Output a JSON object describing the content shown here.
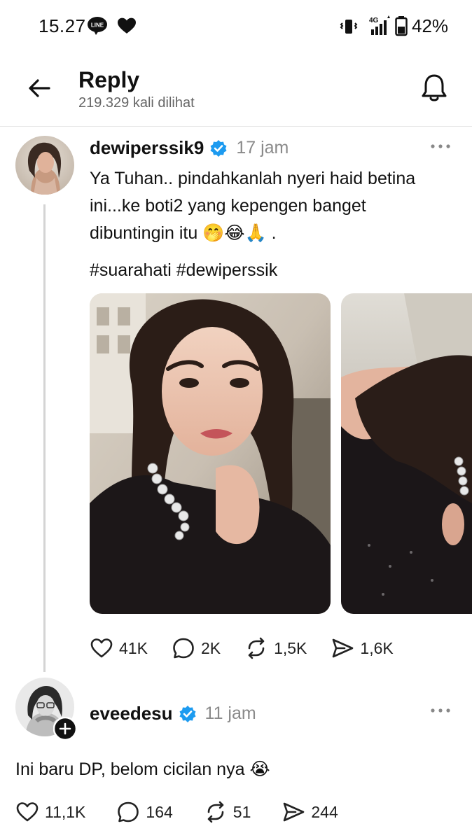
{
  "status_bar": {
    "time": "15.27",
    "line_badge": "LINE",
    "network": "4G",
    "battery": "42%"
  },
  "header": {
    "title": "Reply",
    "views": "219.329 kali dilihat"
  },
  "post": {
    "username": "dewiperssik9",
    "time_ago": "17 jam",
    "text_line1": "Ya Tuhan.. pindahkanlah nyeri haid betina",
    "text_line2": "ini...ke boti2 yang kepengen banget",
    "text_line3": "dibuntingin itu",
    "emojis": "🤭😂🙏",
    "text_end": ".",
    "hashtags": "#suarahati #dewiperssik",
    "likes": "41K",
    "replies": "2K",
    "reposts": "1,5K",
    "shares": "1,6K"
  },
  "reply": {
    "username": "eveedesu",
    "time_ago": "11 jam",
    "text": "Ini baru DP, belom cicilan nya",
    "emoji": "😭",
    "likes": "11,1K",
    "replies": "164",
    "reposts": "51",
    "shares": "244"
  },
  "colors": {
    "verified": "#1d9bf0",
    "muted": "#8a8a8a"
  }
}
